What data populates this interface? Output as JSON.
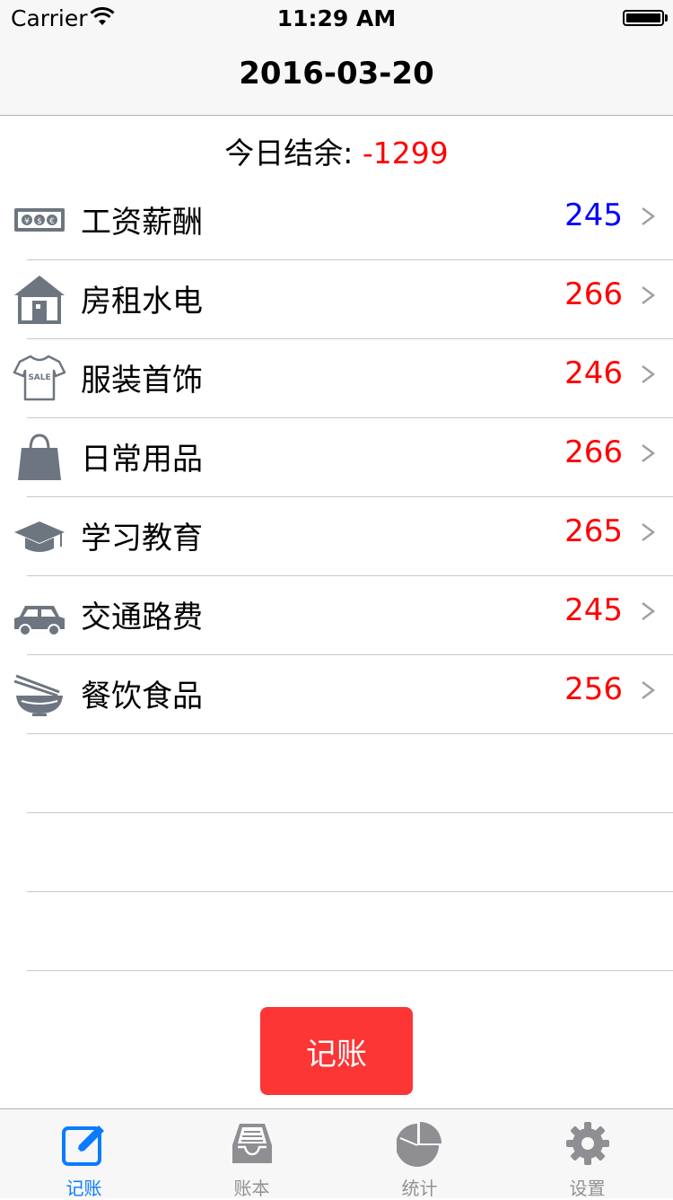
{
  "status_bar": {
    "carrier": "Carrier",
    "time": "11:29 AM"
  },
  "nav": {
    "title": "2016-03-20"
  },
  "balance": {
    "label": "今日结余: ",
    "value": "-1299"
  },
  "categories": [
    {
      "icon": "money-icon",
      "label": "工资薪酬",
      "amount": "245",
      "amount_color": "#0000ff"
    },
    {
      "icon": "house-icon",
      "label": "房租水电",
      "amount": "266",
      "amount_color": "#ff0000"
    },
    {
      "icon": "tshirt-icon",
      "label": "服装首饰",
      "amount": "246",
      "amount_color": "#ff0000"
    },
    {
      "icon": "shopping-bag-icon",
      "label": "日常用品",
      "amount": "266",
      "amount_color": "#ff0000"
    },
    {
      "icon": "graduation-cap-icon",
      "label": "学习教育",
      "amount": "265",
      "amount_color": "#ff0000"
    },
    {
      "icon": "car-icon",
      "label": "交通路费",
      "amount": "245",
      "amount_color": "#ff0000"
    },
    {
      "icon": "bowl-icon",
      "label": "餐饮食品",
      "amount": "256",
      "amount_color": "#ff0000"
    }
  ],
  "record_button": {
    "label": "记账",
    "color": "#fc3535"
  },
  "tabs": [
    {
      "icon": "edit-icon",
      "label": "记账",
      "active": true
    },
    {
      "icon": "inbox-icon",
      "label": "账本",
      "active": false
    },
    {
      "icon": "pie-chart-icon",
      "label": "统计",
      "active": false
    },
    {
      "icon": "gear-icon",
      "label": "设置",
      "active": false
    }
  ],
  "colors": {
    "accent": "#0a7bff",
    "expense": "#ff0000",
    "income": "#0000ff",
    "icon_gray": "#6d7680"
  }
}
